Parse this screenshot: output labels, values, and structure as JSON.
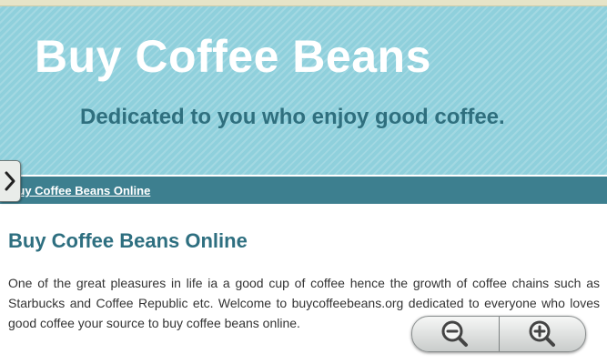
{
  "header": {
    "title": "Buy Coffee Beans",
    "tagline": "Dedicated to you who enjoy good coffee."
  },
  "nav": {
    "link_label": "Buy Coffee Beans Online"
  },
  "main": {
    "heading": "Buy Coffee Beans Online",
    "intro": "One of the great pleasures in life ia a good cup of coffee hence the growth of coffee chains such as Starbucks and Coffee Republic etc.  Welcome to buycoffeebeans.org dedicated to everyone who loves good coffee your source to buy coffee beans online."
  },
  "controls": {
    "side_toggle_icon": "chevron-right-icon",
    "zoom_out_icon": "zoom-out-icon",
    "zoom_in_icon": "zoom-in-icon"
  },
  "colors": {
    "header_bg": "#8fd0dc",
    "title": "#ffffff",
    "tagline": "#2f6f7e",
    "nav_bg": "#3d7f8f",
    "heading": "#2e6f80",
    "body_text": "#333333"
  }
}
